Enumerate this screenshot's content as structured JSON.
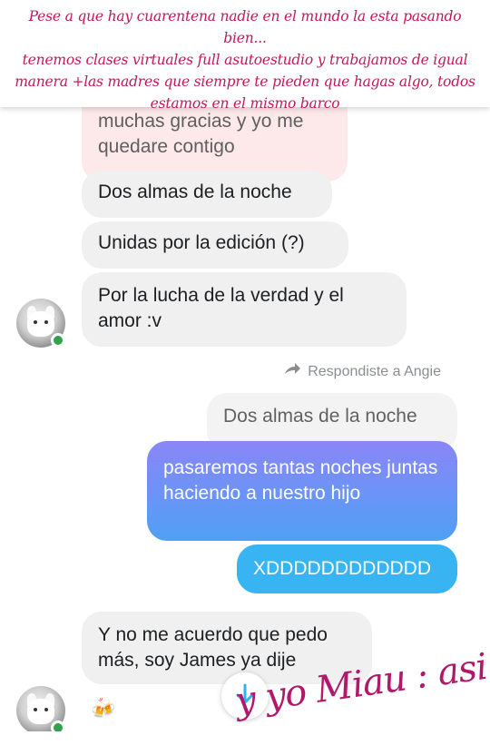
{
  "caption": {
    "lines": [
      "Pese a que hay cuarentena nadie en el mundo la esta pasando bien...",
      "tenemos clases virtuales full asutoestudio y trabajamos de igual",
      "manera +las madres que siempre te pieden que hagas algo, todos",
      "estamos en el mismo barco"
    ]
  },
  "messages": {
    "m1": "muchas gracias y yo me quedare contigo",
    "m2": "Dos almas de la noche",
    "m3": "Unidas por la edición (?)",
    "m4": "Por la lucha de la verdad y el amor :v",
    "reply_label": "Respondiste a Angie",
    "quoted": "Dos almas de la noche",
    "m5": "pasaremos tantas noches juntas haciendo a nuestro hijo",
    "m6": "XDDDDDDDDDDDD",
    "m7": "Y no me acuerdo que pedo más, soy James ya dije",
    "reaction": "🍻"
  },
  "signature": "y yo Miau : asi es !",
  "colors": {
    "caption_text": "#c2185b",
    "online": "#31a24c",
    "sent_gradient_top": "#8a86f5",
    "sent_gradient_bottom": "#4fa0f5",
    "sent_solid": "#39b4f3",
    "signature": "#b0186a"
  },
  "icons": {
    "reply": "reply-arrow-icon",
    "scroll": "arrow-down-icon"
  }
}
